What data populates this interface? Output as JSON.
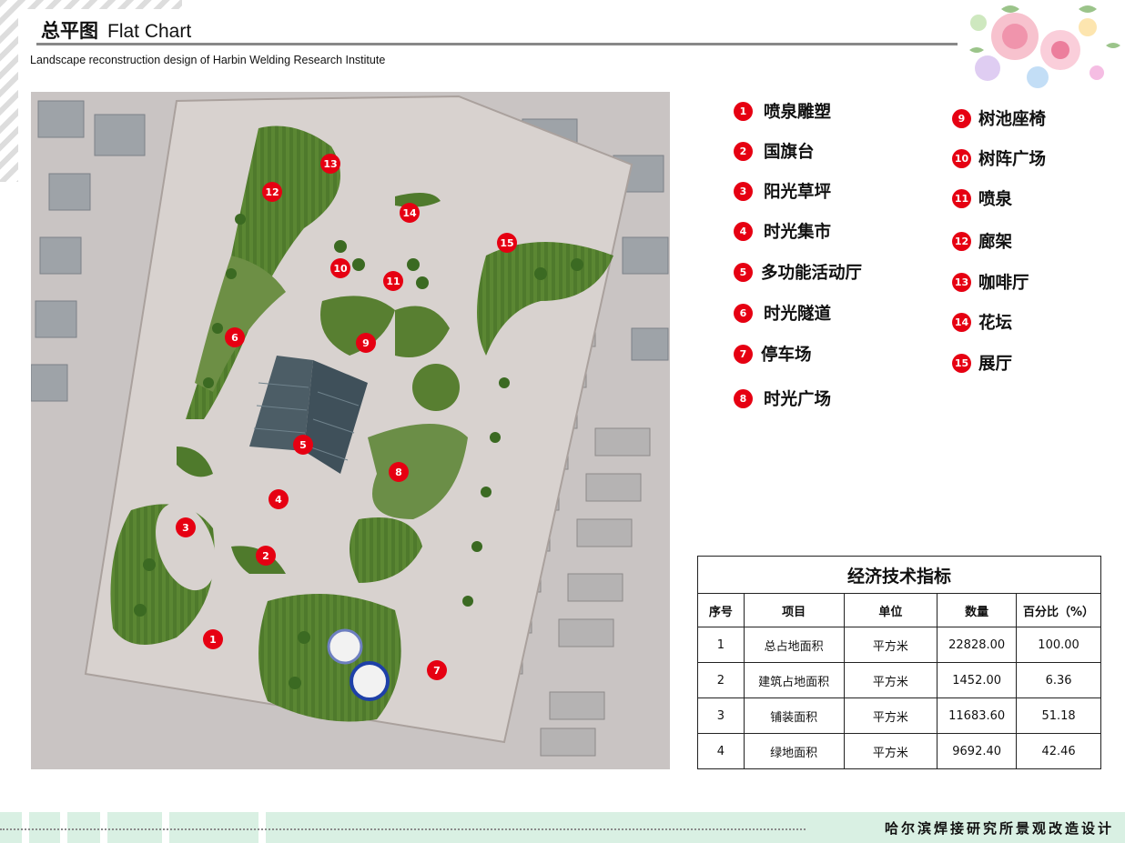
{
  "header": {
    "title_cn": "总平图",
    "title_en": "Flat Chart",
    "subtitle": "Landscape reconstruction design of Harbin Welding Research Institute"
  },
  "accent_color": "#e60012",
  "legend": [
    {
      "num": "1",
      "label": "喷泉雕塑"
    },
    {
      "num": "2",
      "label": "国旗台"
    },
    {
      "num": "3",
      "label": "阳光草坪"
    },
    {
      "num": "4",
      "label": "时光集市"
    },
    {
      "num": "5",
      "label": "多功能活动厅"
    },
    {
      "num": "6",
      "label": "时光隧道"
    },
    {
      "num": "7",
      "label": "停车场"
    },
    {
      "num": "8",
      "label": "时光广场"
    },
    {
      "num": "9",
      "label": "树池座椅"
    },
    {
      "num": "10",
      "label": "树阵广场"
    },
    {
      "num": "11",
      "label": "喷泉"
    },
    {
      "num": "12",
      "label": "廊架"
    },
    {
      "num": "13",
      "label": "咖啡厅"
    },
    {
      "num": "14",
      "label": "花坛"
    },
    {
      "num": "15",
      "label": "展厅"
    }
  ],
  "table": {
    "title": "经济技术指标",
    "headers": [
      "序号",
      "项目",
      "单位",
      "数量",
      "百分比（%）"
    ],
    "rows": [
      [
        "1",
        "总占地面积",
        "平方米",
        "22828.00",
        "100.00"
      ],
      [
        "2",
        "建筑占地面积",
        "平方米",
        "1452.00",
        "6.36"
      ],
      [
        "3",
        "铺装面积",
        "平方米",
        "11683.60",
        "51.18"
      ],
      [
        "4",
        "绿地面积",
        "平方米",
        "9692.40",
        "42.46"
      ]
    ]
  },
  "footer": {
    "title": "哈尔滨焊接研究所景观改造设计"
  }
}
